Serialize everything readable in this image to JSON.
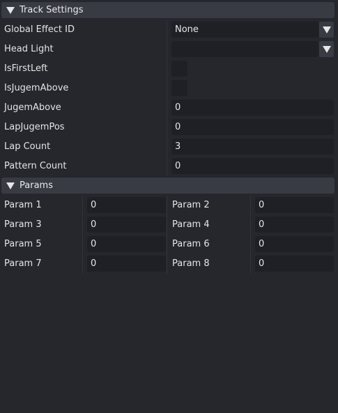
{
  "track_settings": {
    "header": "Track Settings",
    "global_effect_id": {
      "label": "Global Effect ID",
      "value": "None"
    },
    "head_light": {
      "label": "Head Light",
      "value": ""
    },
    "is_first_left": {
      "label": "IsFirstLeft",
      "checked": false
    },
    "is_jugem_above": {
      "label": "IsJugemAbove",
      "checked": false
    },
    "jugem_above": {
      "label": "JugemAbove",
      "value": "0"
    },
    "lap_jugem_pos": {
      "label": "LapJugemPos",
      "value": "0"
    },
    "lap_count": {
      "label": "Lap Count",
      "value": "3"
    },
    "pattern_count": {
      "label": "Pattern Count",
      "value": "0"
    }
  },
  "params": {
    "header": "Params",
    "items": [
      {
        "label": "Param 1",
        "value": "0"
      },
      {
        "label": "Param 2",
        "value": "0"
      },
      {
        "label": "Param 3",
        "value": "0"
      },
      {
        "label": "Param 4",
        "value": "0"
      },
      {
        "label": "Param 5",
        "value": "0"
      },
      {
        "label": "Param 6",
        "value": "0"
      },
      {
        "label": "Param 7",
        "value": "0"
      },
      {
        "label": "Param 8",
        "value": "0"
      }
    ]
  },
  "colors": {
    "background": "#25272d",
    "header": "#383b44",
    "field": "#1e2026",
    "text": "#e6e6e6"
  }
}
